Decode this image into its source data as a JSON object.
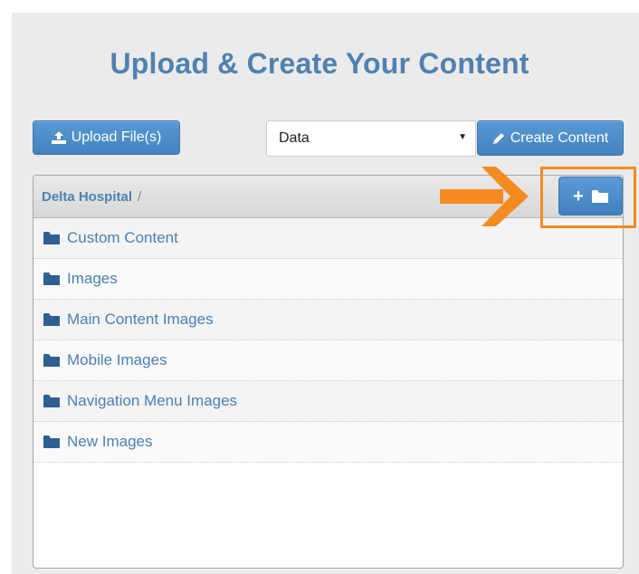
{
  "title": "Upload & Create Your Content",
  "toolbar": {
    "upload_label": "Upload File(s)",
    "select_value": "Data",
    "create_label": "Create Content"
  },
  "breadcrumb": {
    "root": "Delta Hospital",
    "separator": "/"
  },
  "newfolder": {
    "label": "+"
  },
  "folders": [
    {
      "name": "Custom Content"
    },
    {
      "name": "Images"
    },
    {
      "name": "Main Content Images"
    },
    {
      "name": "Mobile Images"
    },
    {
      "name": "Navigation Menu Images"
    },
    {
      "name": "New Images"
    }
  ],
  "colors": {
    "accent": "#4e8fc9",
    "title": "#4f81b0",
    "highlight": "#f48b1f"
  },
  "icons": {
    "upload": "upload-icon",
    "create": "pencil-icon",
    "folder": "folder-icon",
    "caret": "caret-down-icon"
  }
}
